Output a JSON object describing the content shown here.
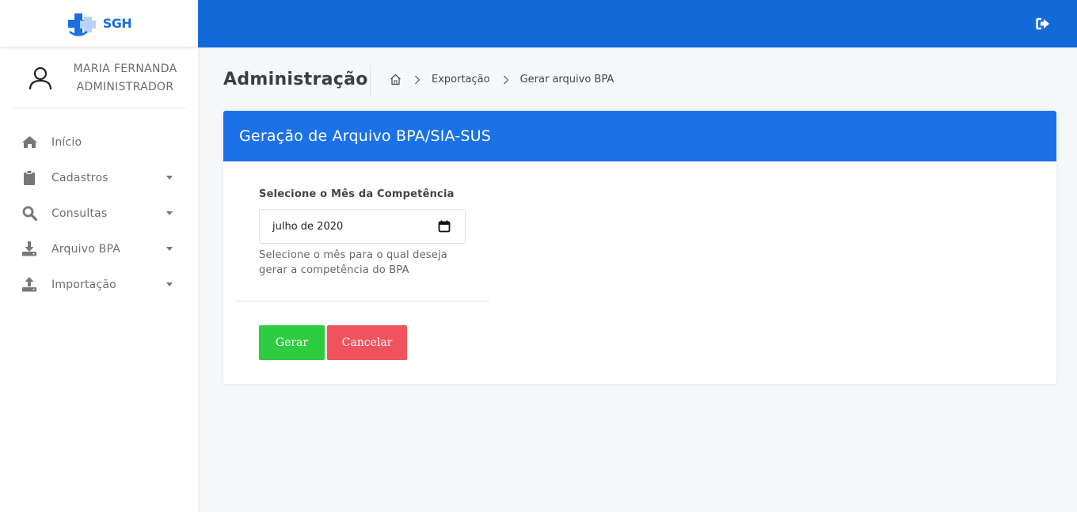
{
  "app": {
    "logo_text": "SGH"
  },
  "user": {
    "name": "MARIA FERNANDA",
    "role": "ADMINISTRADOR"
  },
  "sidebar": {
    "items": [
      {
        "label": "Início",
        "icon": "home-icon",
        "has_submenu": false
      },
      {
        "label": "Cadastros",
        "icon": "clipboard-icon",
        "has_submenu": true
      },
      {
        "label": "Consultas",
        "icon": "search-icon",
        "has_submenu": true
      },
      {
        "label": "Arquivo BPA",
        "icon": "download-icon",
        "has_submenu": true
      },
      {
        "label": "Importação",
        "icon": "upload-icon",
        "has_submenu": true
      }
    ]
  },
  "page": {
    "title": "Administração",
    "breadcrumb": [
      "Exportação",
      "Gerar arquivo BPA"
    ]
  },
  "card": {
    "title": "Geração de Arquivo BPA/SIA-SUS",
    "field_label": "Selecione o Mês da Competência",
    "date_value": "julho de 2020",
    "help_text": "Selecione o mês para o qual deseja gerar a competência do BPA",
    "gerar_label": "Gerar",
    "cancelar_label": "Cancelar"
  },
  "colors": {
    "topbar": "#156ad9",
    "card_header": "#1b72e8",
    "gerar": "#2ecc40",
    "cancelar": "#f0525e"
  }
}
